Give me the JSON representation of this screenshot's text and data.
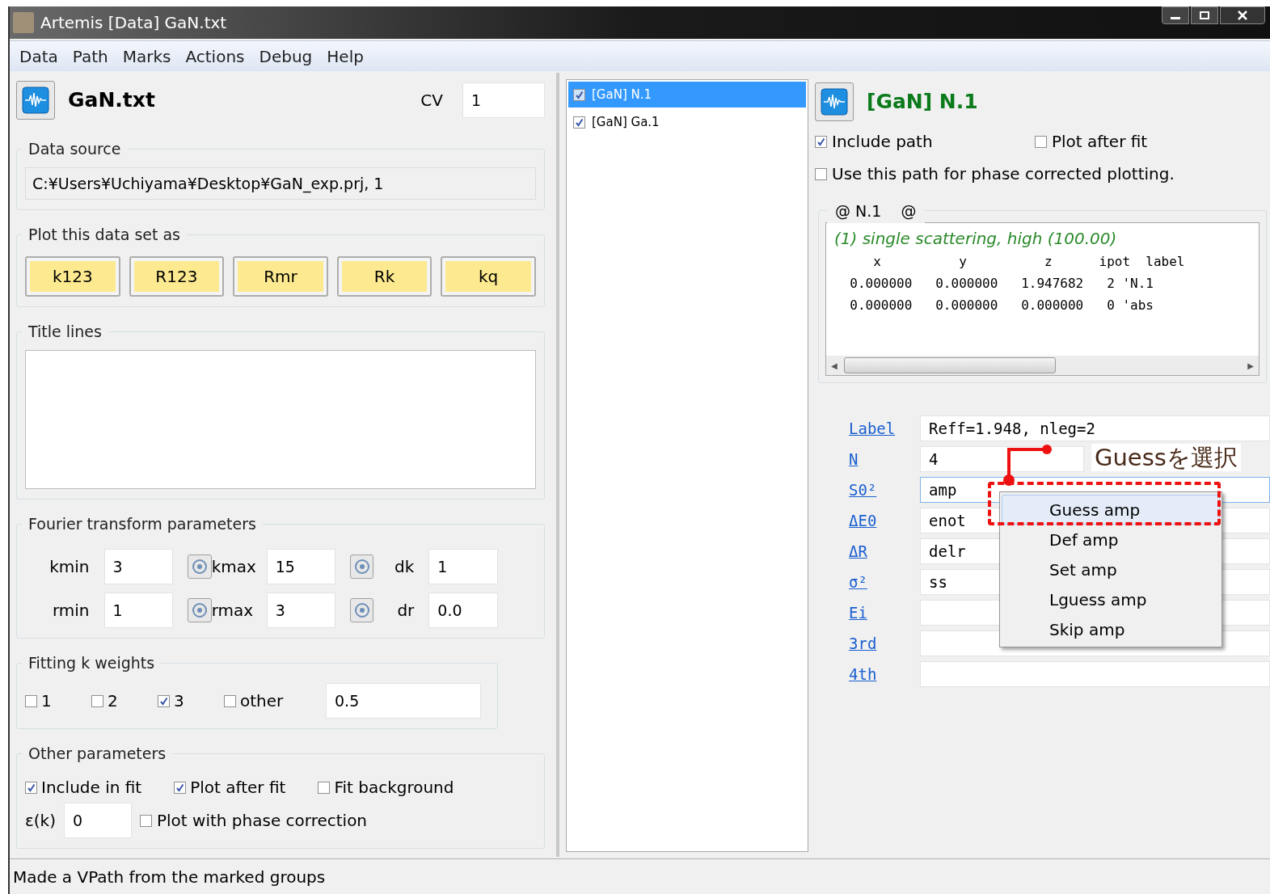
{
  "window": {
    "title": "Artemis [Data] GaN.txt"
  },
  "menu": [
    "Data",
    "Path",
    "Marks",
    "Actions",
    "Debug",
    "Help"
  ],
  "data_panel": {
    "name": "GaN.txt",
    "cv_label": "CV",
    "cv": "1",
    "data_source": {
      "title": "Data source",
      "value": "C:¥Users¥Uchiyama¥Desktop¥GaN_exp.prj, 1"
    },
    "plot": {
      "title": "Plot this data set as",
      "buttons": [
        "k123",
        "R123",
        "Rmr",
        "Rk",
        "kq"
      ]
    },
    "title_lines": {
      "title": "Title lines"
    },
    "fourier": {
      "title": "Fourier transform parameters",
      "fields": [
        {
          "label": "kmin",
          "value": "3",
          "picker": true
        },
        {
          "label": "kmax",
          "value": "15",
          "picker": true
        },
        {
          "label": "dk",
          "value": "1",
          "picker": false
        },
        {
          "label": "rmin",
          "value": "1",
          "picker": true
        },
        {
          "label": "rmax",
          "value": "3",
          "picker": true
        },
        {
          "label": "dr",
          "value": "0.0",
          "picker": false
        }
      ]
    },
    "weights": {
      "title": "Fitting k weights",
      "options": [
        {
          "label": "1",
          "checked": false
        },
        {
          "label": "2",
          "checked": false
        },
        {
          "label": "3",
          "checked": true
        },
        {
          "label": "other",
          "checked": false
        }
      ],
      "other_value": "0.5"
    },
    "other": {
      "title": "Other parameters",
      "options": [
        {
          "label": "Include in fit",
          "checked": true
        },
        {
          "label": "Plot after fit",
          "checked": true
        },
        {
          "label": "Fit background",
          "checked": false
        }
      ],
      "epsilon_label": "ε(k)",
      "epsilon": "0",
      "phase": {
        "label": "Plot with phase correction",
        "checked": false
      }
    }
  },
  "path_list": [
    {
      "label": "[GaN] N.1",
      "checked": true,
      "selected": true
    },
    {
      "label": "[GaN] Ga.1",
      "checked": true,
      "selected": false
    }
  ],
  "path_panel": {
    "name": "[GaN] N.1",
    "options": [
      {
        "label": "Include path",
        "checked": true
      },
      {
        "label": "Plot after fit",
        "checked": false
      }
    ],
    "phase": {
      "label": "Use this path for phase corrected plotting.",
      "checked": false
    },
    "feff": {
      "title": "@ N.1    @",
      "scroll_left": "◀",
      "scroll_right": "▶",
      "description": "(1) single scattering, high (100.00)",
      "lines": [
        "     x          y          z      ipot  label",
        "  0.000000   0.000000   1.947682   2 'N.1",
        "  0.000000   0.000000   0.000000   0 'abs"
      ]
    },
    "params": [
      {
        "label": "Label",
        "value": "Reff=1.948, nleg=2",
        "focused": false
      },
      {
        "label": "N",
        "value": "4",
        "focused": false
      },
      {
        "label": "S0²",
        "value": "amp",
        "focused": true
      },
      {
        "label": "ΔE0",
        "value": "enot",
        "focused": false
      },
      {
        "label": "ΔR",
        "value": "delr",
        "focused": false
      },
      {
        "label": "σ²",
        "value": "ss",
        "focused": false
      },
      {
        "label": "Ei",
        "focused": false
      },
      {
        "label": "3rd",
        "focused": false
      },
      {
        "label": "4th",
        "focused": false
      }
    ],
    "context_menu": [
      {
        "label": "Guess amp",
        "selected": true
      },
      {
        "label": "Def amp",
        "selected": false
      },
      {
        "label": "Set amp",
        "selected": false
      },
      {
        "label": "Lguess amp",
        "selected": false
      },
      {
        "label": "Skip amp",
        "selected": false
      }
    ]
  },
  "annotation": {
    "text": "Guessを選択"
  },
  "status_bar": "Made a VPath from the marked groups"
}
